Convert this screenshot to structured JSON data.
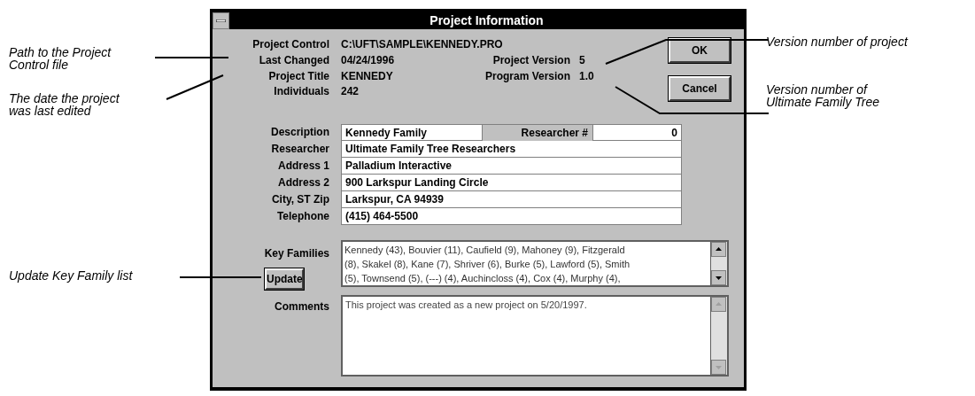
{
  "callouts_left": [
    {
      "lines": [
        "Path to the Project",
        "Control file"
      ]
    },
    {
      "lines": [
        "The date the project",
        "was last edited"
      ]
    },
    {
      "lines": [
        "Update Key Family list"
      ]
    }
  ],
  "callouts_right": [
    {
      "lines": [
        "Version number of project"
      ]
    },
    {
      "lines": [
        "Version number of",
        "Ultimate Family Tree"
      ]
    }
  ],
  "window": {
    "title": "Project Information"
  },
  "info": [
    {
      "label": "Project Control",
      "value": "C:\\UFT\\SAMPLE\\KENNEDY.PRO"
    },
    {
      "label": "Last Changed",
      "value": "04/24/1996"
    },
    {
      "label": "Project Title",
      "value": "KENNEDY"
    },
    {
      "label": "Individuals",
      "value": "242"
    }
  ],
  "versions": [
    {
      "label": "Project Version",
      "value": "5"
    },
    {
      "label": "Program Version",
      "value": "1.0"
    }
  ],
  "buttons": [
    "OK",
    "Cancel"
  ],
  "description": {
    "label": "Description",
    "value": "Kennedy Family",
    "number_label": "Researcher #",
    "number_value": "0"
  },
  "fields": [
    {
      "label": "Researcher",
      "value": "Ultimate Family Tree Researchers"
    },
    {
      "label": "Address 1",
      "value": "Palladium Interactive"
    },
    {
      "label": "Address 2",
      "value": "900 Larkspur Landing Circle"
    },
    {
      "label": "City, ST Zip",
      "value": "Larkspur, CA 94939"
    },
    {
      "label": "Telephone",
      "value": "(415) 464-5500"
    }
  ],
  "key_families": {
    "label": "Key Families",
    "lines": [
      "Kennedy (43), Bouvier (11), Caufield (9), Mahoney (9), Fitzgerald",
      "(8), Skakel (8), Kane (7), Shriver (6), Burke (5), Lawford (5), Smith",
      "(5), Townsend (5), (---) (4), Auchincloss (4), Cox (4), Murphy (4),"
    ],
    "button": "Update"
  },
  "comments": {
    "label": "Comments",
    "value": "This project was created as a new project on 5/20/1997."
  }
}
